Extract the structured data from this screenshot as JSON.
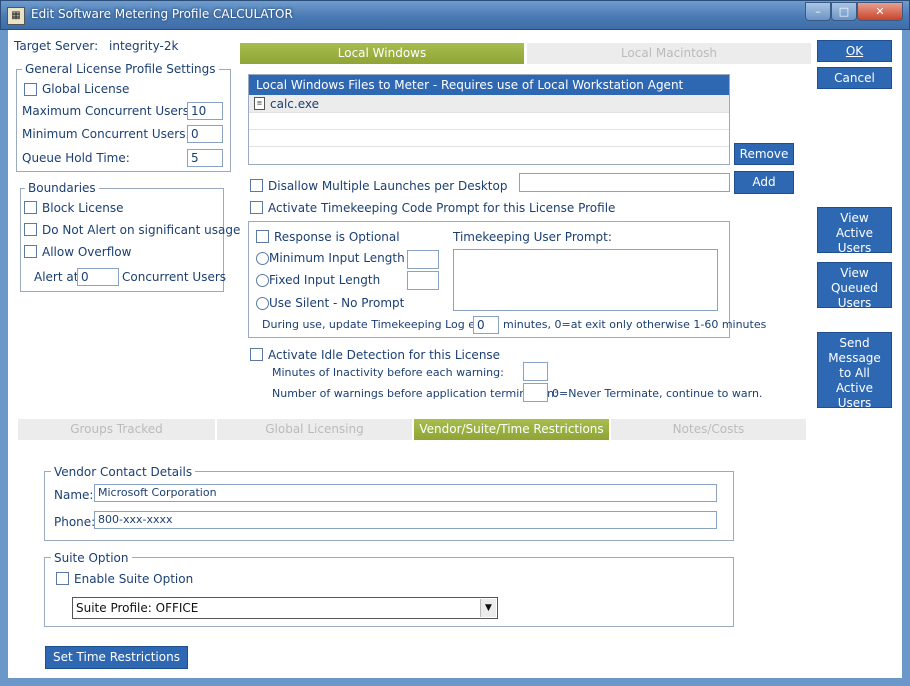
{
  "window": {
    "title": "Edit Software Metering Profile CALCULATOR",
    "icon": "calculator-app-icon",
    "minimize": "–",
    "maximize": "□",
    "close": "✕"
  },
  "server": {
    "label": "Target Server:",
    "value": "integrity-2k"
  },
  "general": {
    "title": "General License Profile Settings",
    "global_license": "Global License",
    "max_users_label": "Maximum Concurrent Users:",
    "max_users": "10",
    "min_users_label": "Minimum Concurrent Users:",
    "min_users": "0",
    "queue_label": "Queue Hold Time:",
    "queue": "5"
  },
  "boundaries": {
    "title": "Boundaries",
    "block_license": "Block License",
    "no_alert": "Do Not Alert on significant usage",
    "allow_overflow": "Allow Overflow",
    "alert_at_label": "Alert at",
    "alert_at": "0",
    "concurrent_label": "Concurrent Users"
  },
  "platform_tabs": [
    {
      "label": "Local Windows",
      "active": true
    },
    {
      "label": "Local Macintosh",
      "active": false
    }
  ],
  "files": {
    "header": "Local Windows Files to Meter - Requires use of Local Workstation Agent",
    "items": [
      "calc.exe"
    ],
    "remove": "Remove",
    "add": "Add",
    "add_value": ""
  },
  "options": {
    "disallow_multiple": "Disallow Multiple Launches per Desktop",
    "timekeeping": "Activate Timekeeping Code Prompt for this License Profile"
  },
  "timekeeping": {
    "response_optional": "Response is Optional",
    "min_length": "Minimum Input Length",
    "fixed_length": "Fixed Input Length",
    "silent": "Use Silent - No Prompt",
    "prompt_label": "Timekeeping User Prompt:",
    "update_label": "During use, update Timekeeping Log every",
    "update_value": "0",
    "update_suffix": "minutes, 0=at exit only otherwise 1-60 minutes"
  },
  "idle": {
    "label": "Activate Idle Detection for this License",
    "minutes_label": "Minutes of Inactivity before each warning:",
    "warnings_label": "Number of warnings before application termination:",
    "warnings_suffix": "0=Never Terminate, continue to warn."
  },
  "side_buttons": {
    "ok": "OK",
    "cancel": "Cancel",
    "view_active": "View Active Users",
    "view_queued": "View Queued Users",
    "send_message": "Send Message to All Active Users"
  },
  "lower_tabs": [
    {
      "label": "Groups Tracked",
      "active": false
    },
    {
      "label": "Global Licensing",
      "active": false
    },
    {
      "label": "Vendor/Suite/Time Restrictions",
      "active": true
    },
    {
      "label": "Notes/Costs",
      "active": false
    }
  ],
  "vendor": {
    "title": "Vendor Contact Details",
    "name_label": "Name:",
    "name": "Microsoft Corporation",
    "phone_label": "Phone:",
    "phone": "800-xxx-xxxx"
  },
  "suite": {
    "title": "Suite Option",
    "enable": "Enable Suite Option",
    "profile": "Suite Profile: OFFICE"
  },
  "time_restrictions": "Set Time Restrictions",
  "colors": {
    "accent": "#2e68b3",
    "tab_active": "#9ab03e",
    "text": "#1b3f73"
  }
}
